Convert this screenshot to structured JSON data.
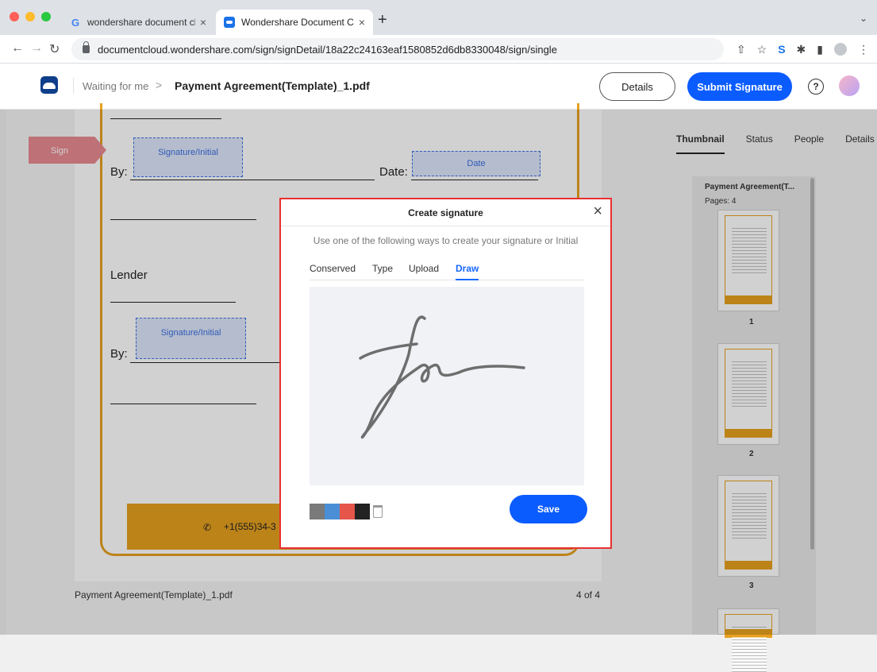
{
  "browser": {
    "tabs": [
      {
        "title": "wondershare document cloud -",
        "close": "×"
      },
      {
        "title": "Wondershare Document Cloud",
        "close": "×"
      }
    ],
    "new_tab": "+",
    "tab_menu": "⌄",
    "url": "documentcloud.wondershare.com/sign/signDetail/18a22c24163eaf1580852d6db8330048/sign/single"
  },
  "header": {
    "breadcrumb_parent": "Waiting for me",
    "breadcrumb_sep": ">",
    "file_name": "Payment Agreement(Template)_1.pdf",
    "details_label": "Details",
    "submit_label": "Submit Signature",
    "help": "?"
  },
  "document": {
    "sign_flag": "Sign",
    "by_label_1": "By:",
    "date_label": "Date:",
    "signature_field_1": "Signature/Initial",
    "date_field": "Date",
    "lender_label": "Lender",
    "by_label_2": "By:",
    "signature_field_2": "Signature/Initial",
    "phone": "+1(555)34-3",
    "footer_name": "Payment Agreement(Template)_1.pdf",
    "page_count": "4 of 4"
  },
  "right_panel": {
    "tabs": [
      "Thumbnail",
      "Status",
      "People",
      "Details"
    ],
    "active_tab": "Thumbnail",
    "doc_title": "Payment Agreement(T...",
    "pages_label": "Pages: 4",
    "thumbnail_numbers": [
      "1",
      "2",
      "3"
    ]
  },
  "modal": {
    "title": "Create signature",
    "close": "×",
    "description": "Use one of the following ways to create your signature or Initial",
    "tabs": [
      "Conserved",
      "Type",
      "Upload",
      "Draw"
    ],
    "active_tab": "Draw",
    "save_label": "Save",
    "colors": [
      "#7a7a7a",
      "#4a8fd6",
      "#e5554a",
      "#222222"
    ]
  }
}
